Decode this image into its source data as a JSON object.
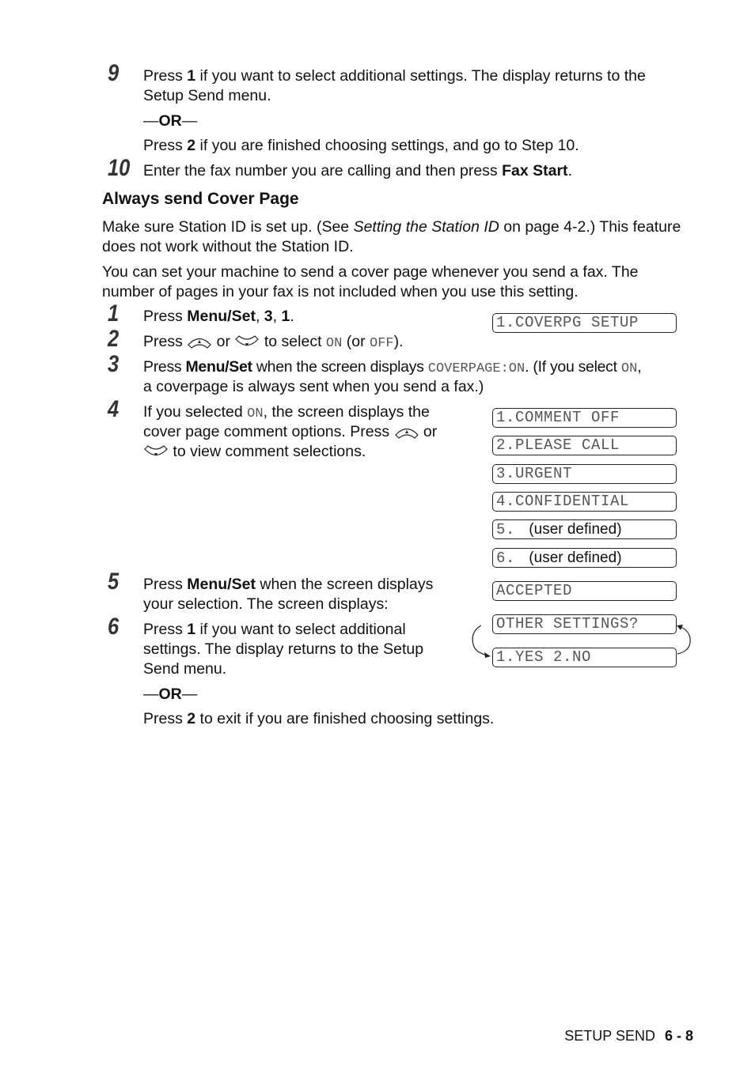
{
  "steps_prev": [
    {
      "num": "9",
      "lines": [
        {
          "pre": "Press ",
          "bold": "1",
          "post": " if you want to select additional settings. The display returns to the"
        },
        {
          "text": "Setup Send menu."
        }
      ]
    },
    {
      "or": "OR"
    },
    {
      "alt": {
        "pre": "Press ",
        "bold": "2",
        "post": " if you are finished choosing settings, and go to Step 10."
      }
    },
    {
      "num": "10",
      "line": {
        "pre": "Enter the fax number you are calling and then press ",
        "bold": "Fax Start",
        "post": "."
      }
    }
  ],
  "section": {
    "heading": "Always send Cover Page",
    "para1": {
      "line1_pre": "Make sure Station ID is set up. (See ",
      "line1_italic": "Setting the Station ID",
      "line1_post": " on page 4-2.) This feature",
      "line2": "does not work without the Station ID."
    },
    "para2": {
      "line1": "You can set your machine to send a cover page whenever you send a fax. The",
      "line2": "number of pages in your fax is not included when you use this setting."
    }
  },
  "steps": [
    {
      "num": "1",
      "pre": "Press ",
      "b1": "Menu/Set",
      "mid": ", ",
      "b2": "3",
      "mid2": ", ",
      "b3": "1",
      "post": "."
    },
    {
      "num": "2",
      "pre": "Press ",
      "or": " or ",
      "mid": " to select ",
      "on": "ON",
      "paren_open": " (or ",
      "off": "OFF",
      "paren_close": ")."
    },
    {
      "num": "3",
      "pre": "Press ",
      "bold": "Menu/Set",
      "mid": " when the screen displays ",
      "mono": "COVERPAGE:ON",
      "mid2": ". (If you select ",
      "on": "ON",
      "post": ",",
      "line2": "a coverpage is always sent when you send a fax.)"
    },
    {
      "num": "4",
      "l1_pre": "If you selected ",
      "on": "ON",
      "l1_post": ", the screen displays the",
      "l2_pre": "cover page comment options. Press ",
      "l2_post": " or",
      "l3": " to view comment selections."
    },
    {
      "num": "5",
      "pre": "Press ",
      "bold": "Menu/Set",
      "post": " when the screen displays",
      "line2": "your selection. The screen displays:"
    },
    {
      "num": "6",
      "pre": "Press ",
      "bold": "1",
      "post": " if you want to select additional",
      "line2": "settings. The display returns to the Setup",
      "line3": "Send menu."
    }
  ],
  "or_label": "OR",
  "final": {
    "pre": "Press ",
    "bold": "2",
    "post": " to exit if you are finished choosing settings."
  },
  "lcd": {
    "coverpg": "1.COVERPG SETUP",
    "comments": [
      {
        "mono": "1.COMMENT OFF"
      },
      {
        "mono": "2.PLEASE CALL"
      },
      {
        "mono": "3.URGENT"
      },
      {
        "mono": "4.CONFIDENTIAL"
      },
      {
        "mono": "5. ",
        "sans": " (user defined)"
      },
      {
        "mono": "6. ",
        "sans": " (user defined)"
      }
    ],
    "accepted": "ACCEPTED",
    "other": "OTHER SETTINGS?",
    "yesno": "1.YES 2.NO"
  },
  "icons": {
    "up": "up-arrow-key-icon",
    "down": "down-arrow-key-icon"
  },
  "footer": {
    "section": "SETUP SEND",
    "page": "6 - 8"
  }
}
